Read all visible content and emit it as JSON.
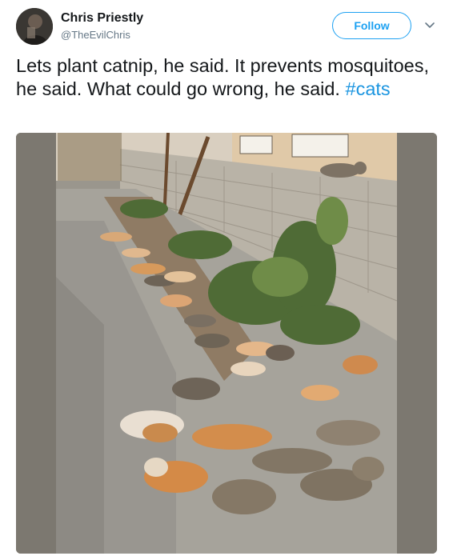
{
  "user": {
    "display_name": "Chris Priestly",
    "handle": "@TheEvilChris",
    "avatar_icon": "user-avatar"
  },
  "follow_button": {
    "label": "Follow"
  },
  "menu": {
    "icon": "chevron-down-icon"
  },
  "tweet": {
    "text": "Lets plant catnip, he said. It prevents mosquitoes, he said. What could go wrong, he said.",
    "hashtag": "#cats"
  },
  "colors": {
    "accent": "#1da1f2",
    "hashtag": "#1b95e0",
    "text": "#14171a",
    "secondary_text": "#657786"
  }
}
